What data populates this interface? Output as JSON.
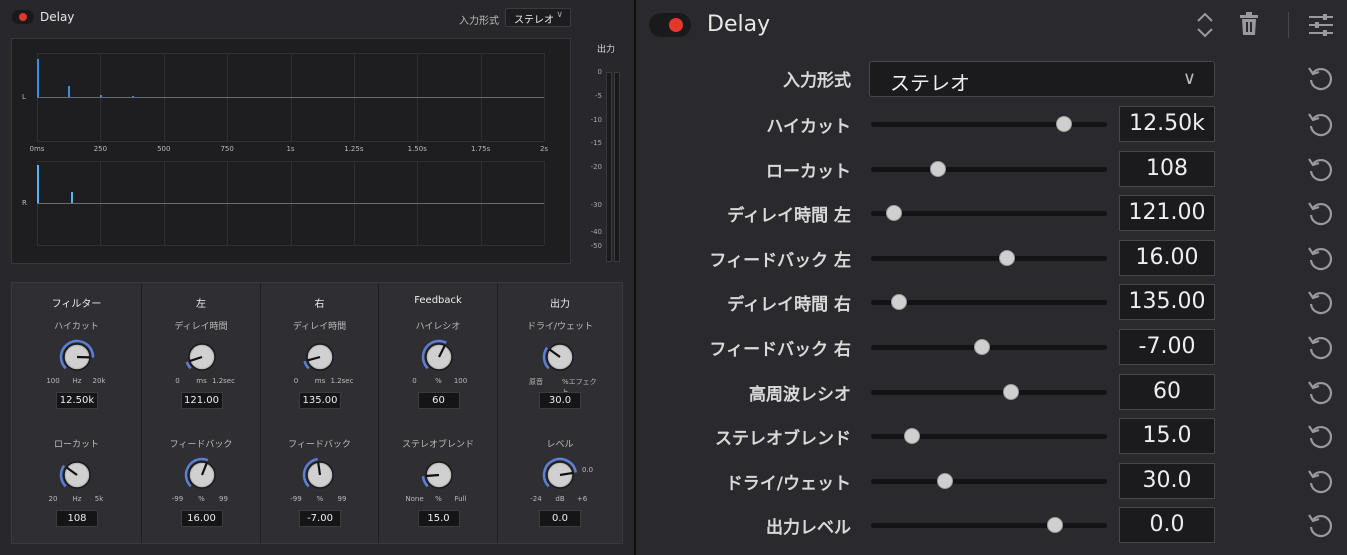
{
  "left_panel": {
    "title": "Delay",
    "input_format_label": "入力形式",
    "input_format_value": "ステレオ",
    "output_label": "出力",
    "graph": {
      "channel_left": "L",
      "channel_right": "R",
      "time_ticks": [
        "0ms",
        "250",
        "500",
        "750",
        "1s",
        "1.25s",
        "1.50s",
        "1.75s",
        "2s"
      ],
      "left_taps_ms": [
        [
          0,
          1.0
        ],
        [
          121,
          0.3
        ],
        [
          250,
          0.05
        ],
        [
          375,
          0.02
        ]
      ],
      "right_taps_ms": [
        [
          0,
          1.0
        ],
        [
          135,
          0.3
        ]
      ]
    },
    "meter_scale": [
      "0",
      "-5",
      "-10",
      "-15",
      "-20",
      "-30",
      "-40",
      "-50"
    ],
    "columns": [
      {
        "title": "フィルター",
        "knobs": [
          {
            "label": "ハイカット",
            "range_min": "100",
            "unit": "Hz",
            "range_max": "20k",
            "value": "12.50k",
            "level": 0.84
          },
          {
            "label": "ローカット",
            "range_min": "20",
            "unit": "Hz",
            "range_max": "5k",
            "value": "108",
            "level": 0.3
          }
        ]
      },
      {
        "title": "左",
        "knobs": [
          {
            "label": "ディレイ時間",
            "range_min": "0",
            "unit": "ms",
            "range_max": "1.2sec",
            "value": "121.00",
            "level": 0.1
          },
          {
            "label": "フィードバック",
            "range_min": "-99",
            "unit": "%",
            "range_max": "99",
            "value": "16.00",
            "level": 0.58
          }
        ]
      },
      {
        "title": "右",
        "knobs": [
          {
            "label": "ディレイ時間",
            "range_min": "0",
            "unit": "ms",
            "range_max": "1.2sec",
            "value": "135.00",
            "level": 0.11
          },
          {
            "label": "フィードバック",
            "range_min": "-99",
            "unit": "%",
            "range_max": "99",
            "value": "-7.00",
            "level": 0.47
          }
        ]
      },
      {
        "title": "Feedback",
        "knobs": [
          {
            "label": "ハイレシオ",
            "range_min": "0",
            "unit": "%",
            "range_max": "100",
            "value": "60",
            "level": 0.6
          },
          {
            "label": "ステレオブレンド",
            "range_min": "None",
            "unit": "%",
            "range_max": "Full",
            "value": "15.0",
            "level": 0.15
          }
        ]
      },
      {
        "title": "出力",
        "knobs": [
          {
            "label": "ドライ/ウェット",
            "range_min": "原音",
            "unit": "",
            "range_max": "%エフェクト",
            "value": "30.0",
            "level": 0.3
          },
          {
            "label": "レベル",
            "range_min": "-24",
            "unit": "dB",
            "range_max": "+6",
            "value": "0.0",
            "level": 0.8,
            "extra": "0.0"
          }
        ]
      }
    ]
  },
  "right_panel": {
    "title": "Delay",
    "icons": [
      "expand-collapse-icon",
      "trash-icon",
      "settings-sliders-icon"
    ],
    "input_format_label": "入力形式",
    "input_format_value": "ステレオ",
    "rows": [
      {
        "label": "ハイカット",
        "value": "12.50k",
        "level": 0.84
      },
      {
        "label": "ローカット",
        "value": "108",
        "level": 0.27
      },
      {
        "label": "ディレイ時間 左",
        "value": "121.00",
        "level": 0.07
      },
      {
        "label": "フィードバック 左",
        "value": "16.00",
        "level": 0.58
      },
      {
        "label": "ディレイ時間 右",
        "value": "135.00",
        "level": 0.09
      },
      {
        "label": "フィードバック 右",
        "value": "-7.00",
        "level": 0.47
      },
      {
        "label": "高周波レシオ",
        "value": "60",
        "level": 0.6
      },
      {
        "label": "ステレオブレンド",
        "value": "15.0",
        "level": 0.15
      },
      {
        "label": "ドライ/ウェット",
        "value": "30.0",
        "level": 0.3
      },
      {
        "label": "出力レベル",
        "value": "0.0",
        "level": 0.8
      }
    ]
  },
  "colors": {
    "accent_red": "#e5372d",
    "knob_arc": "#5b7fd6",
    "tap_blue": "#3a8fe0"
  }
}
